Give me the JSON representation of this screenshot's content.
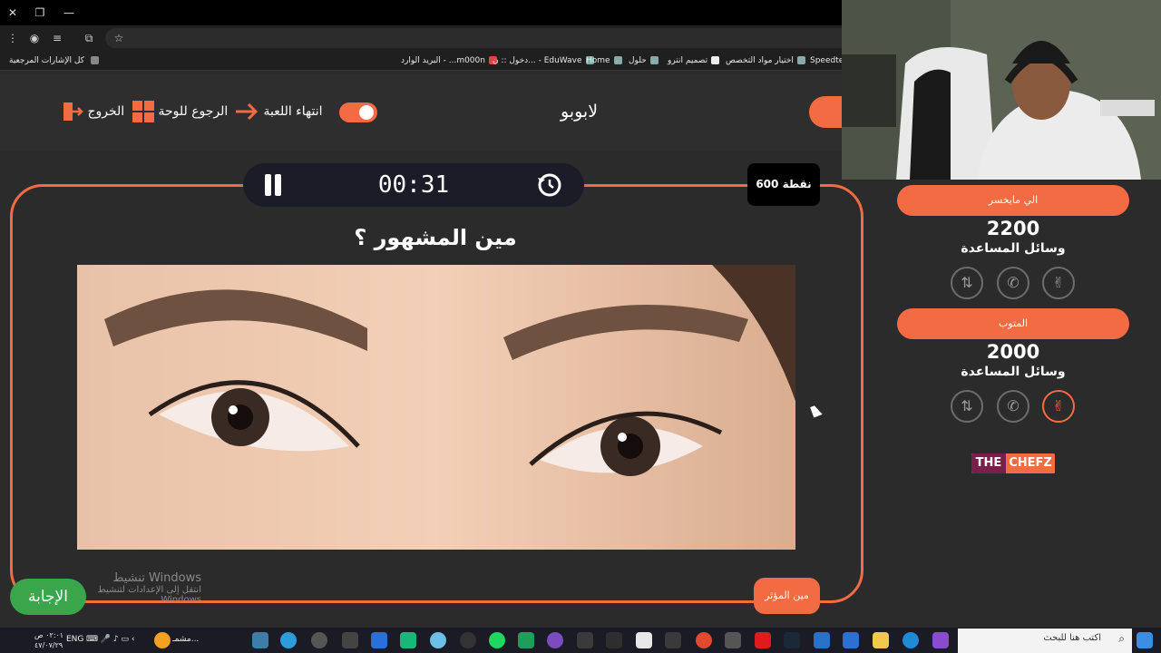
{
  "browser": {
    "bookmarks": [
      {
        "label": "Speedtest"
      },
      {
        "label": "اختيار مواد التخصص"
      },
      {
        "label": "تصميم انترو"
      },
      {
        "label": "حلول"
      },
      {
        "label": "Home"
      },
      {
        "label": "دخول :: ن... - EduWave"
      },
      {
        "label": "البريد الوارد - ...m000n"
      }
    ],
    "all_bookmarks_label": "كل الإشارات المرجعية"
  },
  "header": {
    "brand": "لابوبو",
    "end_game_label": "انتهاء اللعبة",
    "back_to_board_label": "الرجوع للوحة",
    "exit_label": "الخروج"
  },
  "game": {
    "timer": "00:31",
    "points": "600 نقطة",
    "question": "مين المشهور ؟",
    "who_button": "مين المؤثر",
    "answer_button": "الإجابة"
  },
  "windows_activation": {
    "line1": "تنشيط Windows",
    "line2": "انتقل إلى الإعدادات لتنشيط Windows"
  },
  "teams": [
    {
      "name": "الي مايخسر",
      "score": "2200",
      "aids_label": "وسائل المساعدة"
    },
    {
      "name": "المتوب",
      "score": "2000",
      "aids_label": "وسائل المساعدة"
    }
  ],
  "logo": {
    "part1": "THE",
    "part2": "CHEFZ"
  },
  "taskbar": {
    "search_placeholder": "اكتب هنا للبحث",
    "lang": "ENG",
    "time": "٠٢:٠١ ص",
    "date": "٤٧/٠٧/٢٩",
    "weather": "مشمـ..."
  },
  "colors": {
    "accent": "#f26b43",
    "answer": "#3aa54b",
    "background": "#2b2b2b"
  }
}
